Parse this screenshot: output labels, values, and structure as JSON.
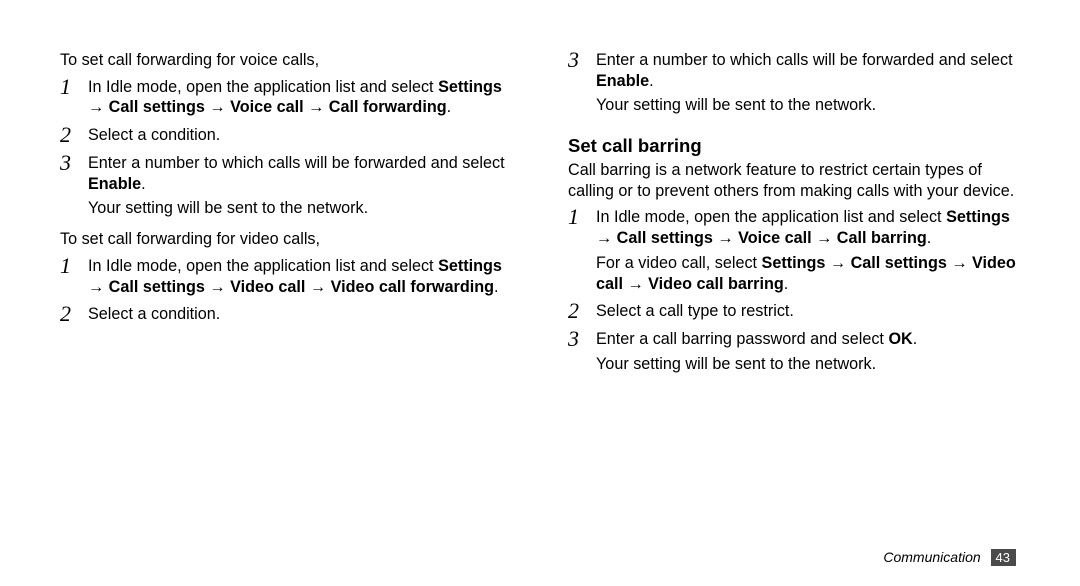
{
  "left": {
    "intro_voice": "To set call forwarding for voice calls,",
    "voice_steps": [
      {
        "num": "1",
        "pre": "In Idle mode, open the application list and select ",
        "bold": "Settings → Call settings → Voice call → Call forwarding",
        "post": "."
      },
      {
        "num": "2",
        "pre": "Select a condition.",
        "bold": "",
        "post": ""
      },
      {
        "num": "3",
        "pre": "Enter a number to which calls will be forwarded and select ",
        "bold": "Enable",
        "post": ".",
        "after": "Your setting will be sent to the network."
      }
    ],
    "intro_video": "To set call forwarding for video calls,",
    "video_steps": [
      {
        "num": "1",
        "pre": "In Idle mode, open the application list and select ",
        "bold": "Settings → Call settings → Video call → Video call forwarding",
        "post": "."
      },
      {
        "num": "2",
        "pre": "Select a condition.",
        "bold": "",
        "post": ""
      }
    ]
  },
  "right": {
    "cont_steps": [
      {
        "num": "3",
        "pre": "Enter a number to which calls will be forwarded and select ",
        "bold": "Enable",
        "post": ".",
        "after": "Your setting will be sent to the network."
      }
    ],
    "heading": "Set call barring",
    "barring_intro": "Call barring is a network feature to restrict certain types of calling or to prevent others from making calls with your device.",
    "barring_steps": [
      {
        "num": "1",
        "line1_pre": "In Idle mode, open the application list and select ",
        "line1_bold": "Settings → Call settings → Voice call → Call barring",
        "line1_post": ".",
        "line2_pre": "For a video call, select ",
        "line2_bold": "Settings → Call settings → Video call → Video call barring",
        "line2_post": "."
      },
      {
        "num": "2",
        "line1_pre": "Select a call type to restrict.",
        "line1_bold": "",
        "line1_post": ""
      },
      {
        "num": "3",
        "line1_pre": "Enter a call barring password and select ",
        "line1_bold": "OK",
        "line1_post": ".",
        "after": "Your setting will be sent to the network."
      }
    ]
  },
  "footer": {
    "section": "Communication",
    "page": "43"
  }
}
